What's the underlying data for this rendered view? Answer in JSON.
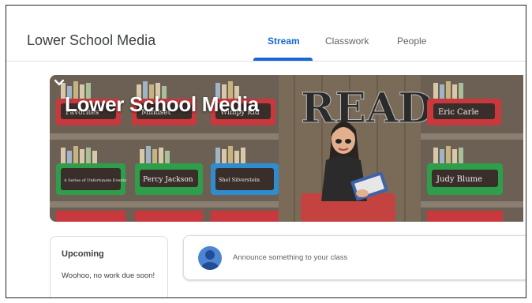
{
  "header": {
    "class_title": "Lower School Media",
    "tabs": [
      {
        "label": "Stream",
        "active": true
      },
      {
        "label": "Classwork",
        "active": false
      },
      {
        "label": "People",
        "active": false
      }
    ]
  },
  "banner": {
    "title": "Lower School Media",
    "wall_text": "READ",
    "bin_labels": [
      "Favorites",
      "Mindset",
      "Wimpy Kid",
      "Eric Carle",
      "A Series of Unfortunate Events",
      "Percy Jackson",
      "Shel Silverstein",
      "Judy Blume"
    ],
    "expand_icon": "chevron-down-icon"
  },
  "upcoming": {
    "title": "Upcoming",
    "text": "Woohoo, no work due soon!"
  },
  "announce": {
    "placeholder": "Announce something to your class",
    "avatar_icon": "person-icon"
  },
  "colors": {
    "accent": "#1967d2",
    "avatar": "#4e84d2",
    "bin_red": "#c9383d",
    "bin_green": "#2e9e4a",
    "bin_blue": "#2f8ccf"
  }
}
